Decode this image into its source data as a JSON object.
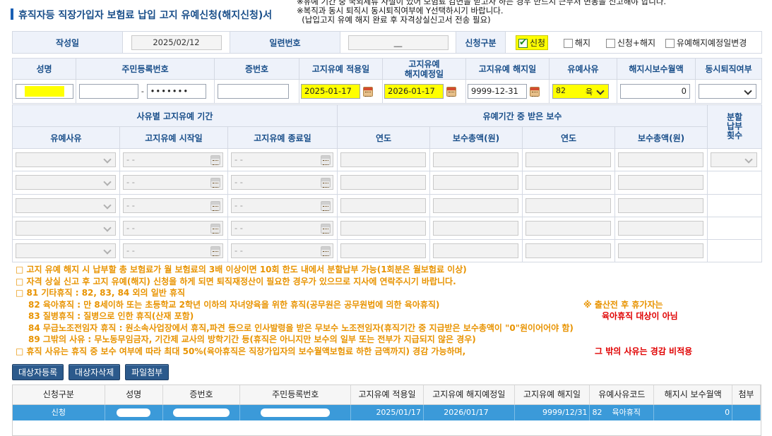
{
  "title": "휴직자등 직장가입자 보험료 납입 고지 유예신청(해지신청)서",
  "notes": [
    "※유예 기간 중 국외체류 사실이 있어 보험료 감면을 받고자 하는 경우 반드시 근무처 변동을 신고해야 합니다.",
    "※복직과 동시 퇴직시 동시퇴직여부에 Y선택하시기 바랍니다.",
    "  (납입고지 유예 해지 완료 후 자격상실신고서 전송 필요)"
  ],
  "row1": {
    "date_label": "작성일",
    "date_value": "2025/02/12",
    "serial_label": "일련번호",
    "serial_value": "__",
    "type_label": "신청구분",
    "options": [
      {
        "label": "신청",
        "checked": true
      },
      {
        "label": "해지",
        "checked": false
      },
      {
        "label": "신청+해지",
        "checked": false
      },
      {
        "label": "유예해지예정일변경",
        "checked": false
      }
    ]
  },
  "row2": {
    "headers": [
      "성명",
      "주민등록번호",
      "증번호",
      "고지유예 적용일",
      "고지유예\n해지예정일",
      "고지유예 해지일",
      "유예사유",
      "해지시보수월액",
      "동시퇴직여부"
    ],
    "name_value": "",
    "rrn_front": "",
    "rrn_back": "•••••••",
    "cert_no": "",
    "apply_date": "2025-01-17",
    "expected_end": "2026-01-17",
    "end_date": "9999-12-31",
    "reason_code": "82",
    "reason_text": "육",
    "salary": "0",
    "retire_flag": ""
  },
  "period_table": {
    "group1": "사유별 고지유예 기간",
    "group2": "유예기간 중 받은 보수",
    "installment": "분할\n납부\n횟수",
    "cols": [
      "유예사유",
      "고지유예 시작일",
      "고지유예 종료일",
      "연도",
      "보수총액(원)",
      "연도",
      "보수총액(원)"
    ],
    "date_placeholder": "- -",
    "rows": 5
  },
  "info": [
    {
      "text": "□ 고지 유예 해지 시 납부할 총 보험료가 월 보험료의 3배 이상이면 10회 한도 내에서 분할납부 가능(1회분은 월보험료 이상)",
      "color": "orange"
    },
    {
      "text": "□ 자격 상실 신고 후 고지 유예(해지) 신청을 하게 되면 퇴직재정산이 필요한 경우가 있으므로 지사에 연락주시기 바랍니다.",
      "color": "orange"
    },
    {
      "text": "□ 81 기타휴직 : 82, 83, 84 외의 일반 휴직",
      "color": "orange"
    },
    {
      "text": "82 육아휴직 : 만 8세이하 또는 초등학교 2학년 이하의 자녀양육을 위한 휴직(공무원은 공무원법에 의한 육아휴직)",
      "color": "orange",
      "indent": true,
      "extra": "※ 출산전 후 휴가자는",
      "extra_color": "orange"
    },
    {
      "text": "83 질병휴직 : 질병으로 인한 휴직(산재 포함)",
      "color": "orange",
      "indent": true,
      "extra": "육아휴직 대상이 아님",
      "extra_color": "red"
    },
    {
      "text": "84 무급노조전임자 휴직 : 원소속사업장에서 휴직,파견 등으로 인사발령을 받은 무보수 노조전임자(휴직기간 중 지급받은 보수총액이 \"0\"원이어어야 함)",
      "color": "orange",
      "indent": true
    },
    {
      "text": "89 그밖의 사유 : 무노동무임금자, 기간제 교사의 방학기간 등(휴직은 아니지만 보수의 일부 또는 전부가 지급되지 않은 경우)",
      "color": "orange",
      "indent": true
    },
    {
      "text": "□ 휴직 사유는 휴직 중 보수 여부에 따라 최대 50%(육아휴직은 직장가입자의 보수월액보험료 하한 금액까지) 경감 가능하며,",
      "color": "orange",
      "extra": "그 밖의 사유는 경감 비적용",
      "extra_color": "red"
    }
  ],
  "buttons": [
    "대상자등록",
    "대상자삭제",
    "파일첨부"
  ],
  "grid": {
    "headers": [
      "신청구분",
      "성명",
      "증번호",
      "주민등록번호",
      "고지유예 적용일",
      "고지유예 해지예정일",
      "고지유예 해지일",
      "유예사유코드",
      "해지시 보수월액",
      "첨부"
    ],
    "row": {
      "type": "신청",
      "apply": "2025/01/17",
      "expected": "2026/01/17",
      "end": "9999/12/31",
      "reason_code": "82",
      "reason_name": "육아휴직",
      "salary": "0"
    }
  },
  "colors": {
    "accent": "#1a4f8a",
    "highlight": "#ffff00",
    "orange": "#e89300",
    "red": "#e00000",
    "selected_row": "#3b9ad9"
  }
}
